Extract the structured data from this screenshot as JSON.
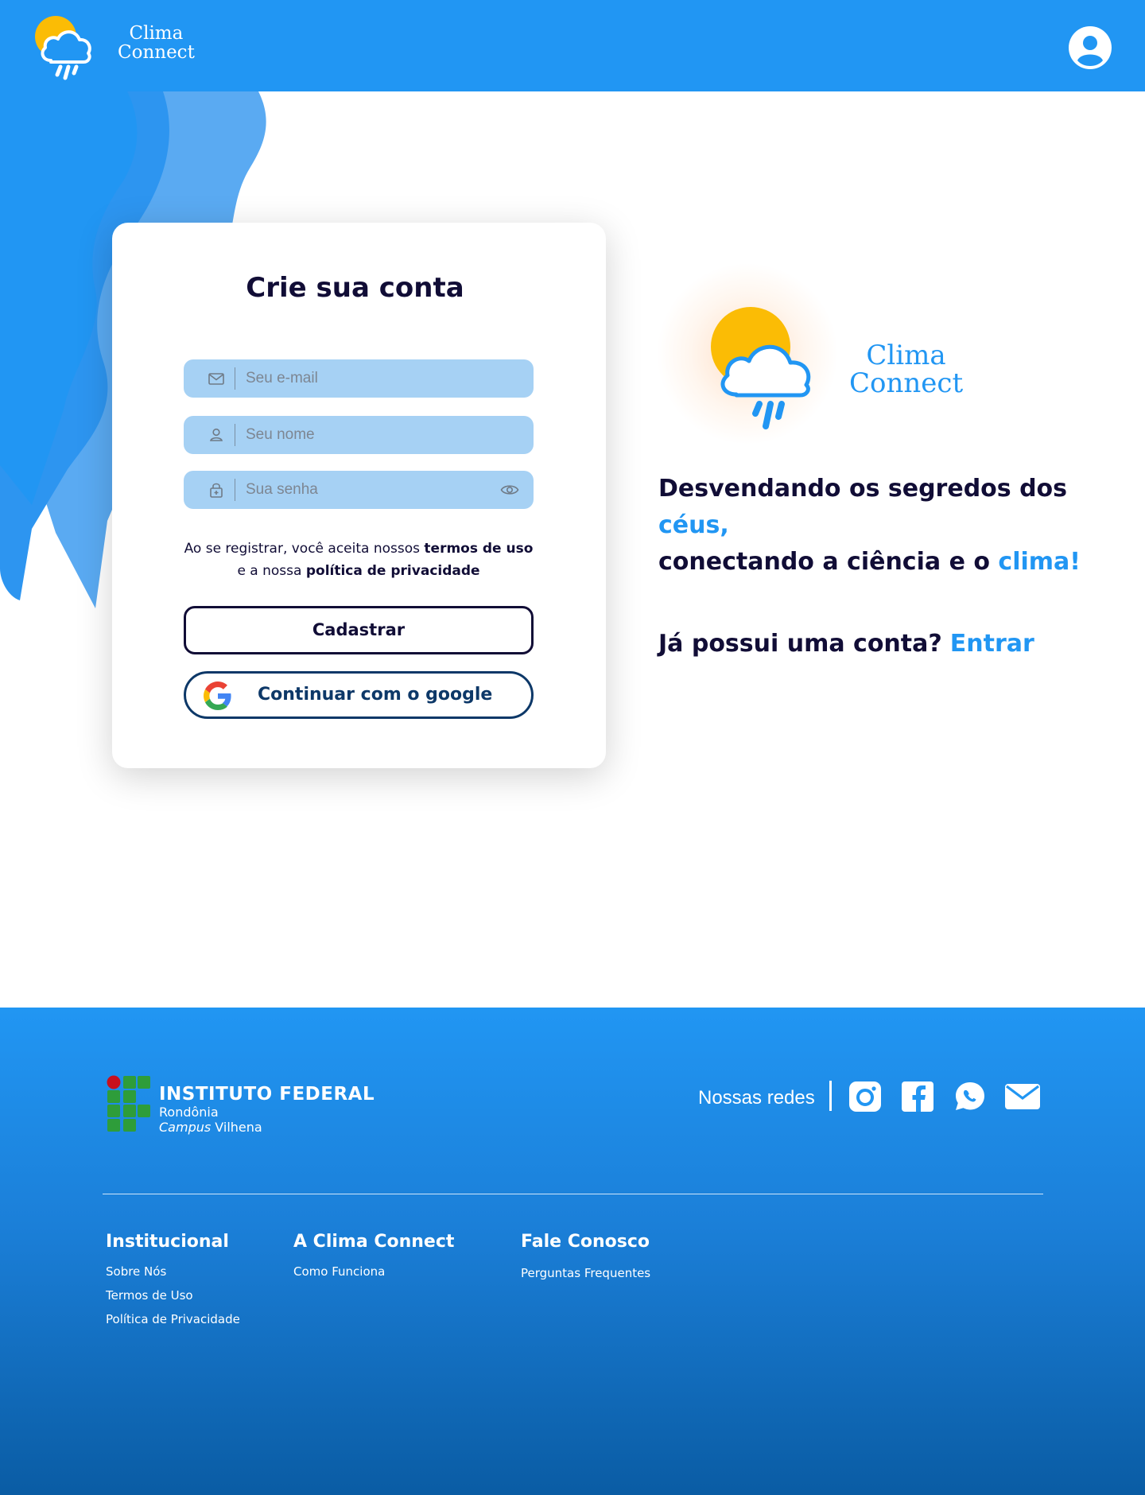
{
  "header": {
    "brand_line1": "Clima",
    "brand_line2": "Connect",
    "profile_icon": "user-circle-icon"
  },
  "signup": {
    "title": "Crie sua conta",
    "email_placeholder": "Seu e-mail",
    "name_placeholder": "Seu nome",
    "password_placeholder": "Sua senha",
    "terms_part1": "Ao se registrar, você aceita nossos ",
    "terms_link1": "termos de uso",
    "terms_part2": "e a nossa ",
    "terms_link2": "política de privacidade",
    "submit_label": "Cadastrar",
    "google_label": "Continuar com o google"
  },
  "hero": {
    "brand_line1": "Clima",
    "brand_line2": "Connect",
    "tagline_part1": "Desvendando os segredos dos ",
    "tagline_accent1": "céus,",
    "tagline_part2": "conectando a ciência e o ",
    "tagline_accent2": "clima!",
    "login_prompt": "Já possui uma conta?",
    "login_link": "Entrar"
  },
  "footer": {
    "institute_title": "INSTITUTO FEDERAL",
    "institute_state": "Rondônia",
    "institute_campus_word": "Campus",
    "institute_campus_name": " Vilhena",
    "social_label": "Nossas redes",
    "social_icons": [
      "instagram-icon",
      "facebook-icon",
      "whatsapp-icon",
      "mail-icon"
    ],
    "columns": [
      {
        "title": "Institucional",
        "links": [
          "Sobre Nós",
          "Termos de Uso",
          "Política de Privacidade"
        ]
      },
      {
        "title": "A Clima Connect",
        "links": [
          "Como Funciona"
        ]
      },
      {
        "title": "Fale Conosco",
        "links": [
          "Perguntas Frequentes"
        ]
      }
    ]
  },
  "colors": {
    "primary": "#2196f3",
    "dark_navy": "#110d36",
    "field_bg": "#a6d1f4",
    "sun": "#fbbc05"
  }
}
